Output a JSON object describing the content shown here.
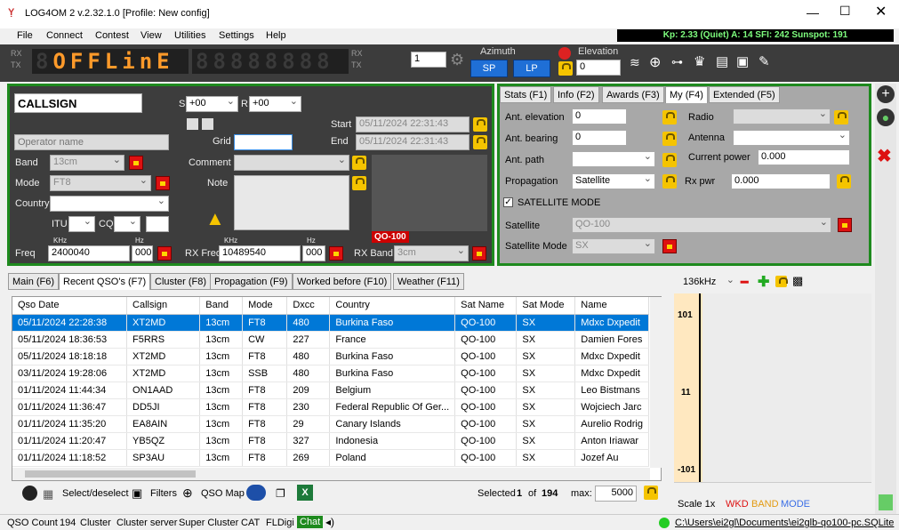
{
  "window": {
    "title": "LOG4OM 2 v.2.32.1.0 [Profile: New config]"
  },
  "menu": [
    "File",
    "Connect",
    "Contest",
    "View",
    "Utilities",
    "Settings",
    "Help"
  ],
  "status_kp": "Kp: 2.33 (Quiet)  A: 14  SFI: 242  Sunspot: 191",
  "toolbar": {
    "rx": "RX",
    "tx": "TX",
    "display": "OFFLinE",
    "vfo_value": "1",
    "azimuth_label": "Azimuth",
    "sp": "SP",
    "lp": "LP",
    "elevation_label": "Elevation",
    "elevation_value": "0"
  },
  "qso": {
    "callsign": "CALLSIGN",
    "operator_placeholder": "Operator name",
    "s_label": "S",
    "s_value": "+00",
    "r_label": "R",
    "r_value": "+00",
    "start_label": "Start",
    "start_value": "05/11/2024 22:31:43",
    "end_label": "End",
    "end_value": "05/11/2024 22:31:43",
    "grid_label": "Grid",
    "band_label": "Band",
    "band_value": "13cm",
    "mode_label": "Mode",
    "mode_value": "FT8",
    "country_label": "Country",
    "comment_label": "Comment",
    "note_label": "Note",
    "itu_label": "ITU",
    "cq_label": "CQ",
    "khz": "KHz",
    "hz": "Hz",
    "freq_label": "Freq",
    "freq_value": "2400040",
    "freq_hz": "000",
    "rxfreq_label": "RX Freq",
    "rxfreq_value": "10489540",
    "rxfreq_hz": "000",
    "rxband_label": "RX Band",
    "rxband_value": "3cm",
    "qo_badge": "QO-100"
  },
  "right_tabs": [
    "Stats (F1)",
    "Info (F2)",
    "Awards (F3)",
    "My (F4)",
    "Extended (F5)"
  ],
  "my": {
    "ant_elevation": "Ant. elevation",
    "ant_elevation_value": "0",
    "ant_bearing": "Ant. bearing",
    "ant_bearing_value": "0",
    "ant_path": "Ant. path",
    "propagation": "Propagation",
    "propagation_value": "Satellite",
    "radio": "Radio",
    "antenna": "Antenna",
    "current_power": "Current power",
    "current_power_value": "0.000",
    "rx_pwr": "Rx pwr",
    "rx_pwr_value": "0.000",
    "satellite_mode_chk": "SATELLITE MODE",
    "satellite": "Satellite",
    "satellite_value": "QO-100",
    "satellite_mode": "Satellite Mode",
    "satellite_mode_value": "SX"
  },
  "bottom_tabs": [
    "Main (F6)",
    "Recent QSO's (F7)",
    "Cluster (F8)",
    "Propagation (F9)",
    "Worked before (F10)",
    "Weather (F11)"
  ],
  "grid_headers": [
    "Qso Date",
    "Callsign",
    "Band",
    "Mode",
    "Dxcc",
    "Country",
    "Sat Name",
    "Sat Mode",
    "Name"
  ],
  "grid_rows": [
    [
      "05/11/2024 22:28:38",
      "XT2MD",
      "13cm",
      "FT8",
      "480",
      "Burkina Faso",
      "QO-100",
      "SX",
      "Mdxc Dxpedit"
    ],
    [
      "05/11/2024 18:36:53",
      "F5RRS",
      "13cm",
      "CW",
      "227",
      "France",
      "QO-100",
      "SX",
      "Damien Fores"
    ],
    [
      "05/11/2024 18:18:18",
      "XT2MD",
      "13cm",
      "FT8",
      "480",
      "Burkina Faso",
      "QO-100",
      "SX",
      "Mdxc Dxpedit"
    ],
    [
      "03/11/2024 19:28:06",
      "XT2MD",
      "13cm",
      "SSB",
      "480",
      "Burkina Faso",
      "QO-100",
      "SX",
      "Mdxc Dxpedit"
    ],
    [
      "01/11/2024 11:44:34",
      "ON1AAD",
      "13cm",
      "FT8",
      "209",
      "Belgium",
      "QO-100",
      "SX",
      "Leo Bistmans"
    ],
    [
      "01/11/2024 11:36:47",
      "DD5JI",
      "13cm",
      "FT8",
      "230",
      "Federal Republic Of Ger...",
      "QO-100",
      "SX",
      "Wojciech Jarc"
    ],
    [
      "01/11/2024 11:35:20",
      "EA8AIN",
      "13cm",
      "FT8",
      "29",
      "Canary Islands",
      "QO-100",
      "SX",
      "Aurelio Rodrig"
    ],
    [
      "01/11/2024 11:20:47",
      "YB5QZ",
      "13cm",
      "FT8",
      "327",
      "Indonesia",
      "QO-100",
      "SX",
      "Anton Iriawar"
    ],
    [
      "01/11/2024 11:18:52",
      "SP3AU",
      "13cm",
      "FT8",
      "269",
      "Poland",
      "QO-100",
      "SX",
      "Jozef Au"
    ]
  ],
  "grid_footer": {
    "select_deselect": "Select/deselect",
    "filters": "Filters",
    "qso_map": "QSO Map",
    "selected": "Selected",
    "selected_n": "1",
    "of": "of",
    "total": "194",
    "max": "max:",
    "max_value": "5000"
  },
  "bandmap": {
    "span": "136kHz",
    "tick1": "101",
    "tick2": "11",
    "tick3": "-101",
    "scale": "Scale 1x",
    "wkd": "WKD",
    "band": "BAND",
    "mode": "MODE"
  },
  "statusbar": {
    "qso_count_label": "QSO Count",
    "qso_count": "194",
    "items": [
      "Cluster",
      "Cluster server",
      "Super Cluster",
      "CAT",
      "FLDigi",
      "Chat"
    ],
    "db_path": "C:\\Users\\ei2gl\\Documents\\ei2glb-qo100-pc.SQLite"
  }
}
